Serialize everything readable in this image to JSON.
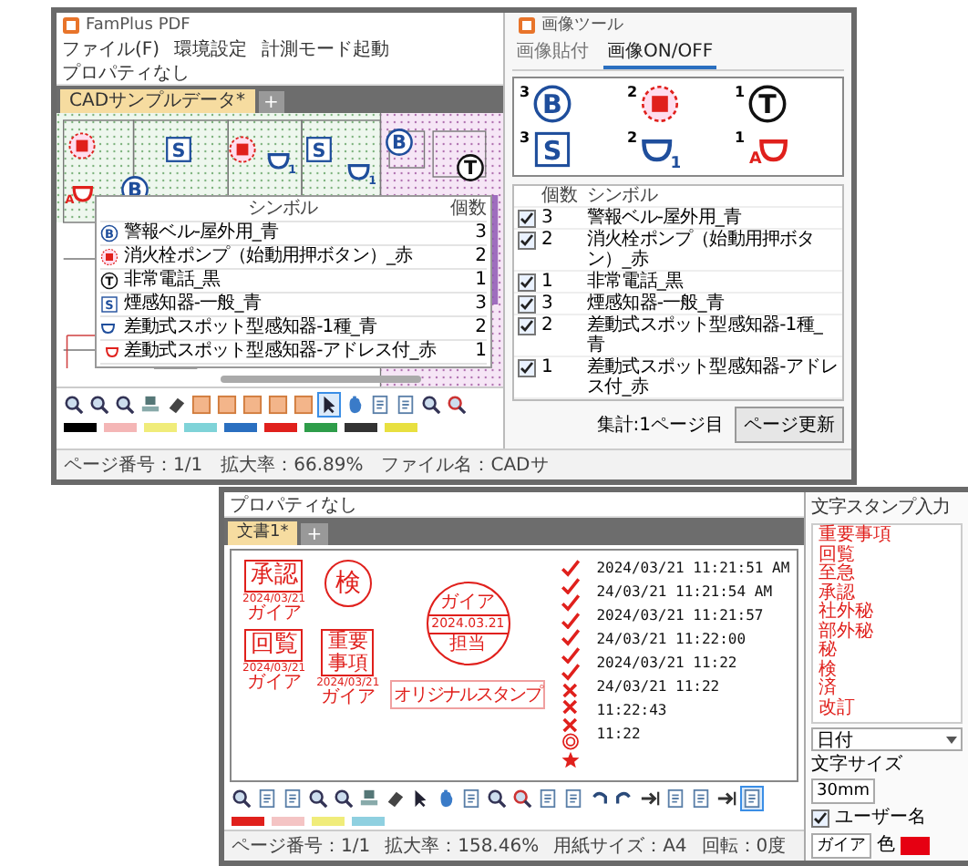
{
  "doc_window": {
    "title": "FamPlus PDF",
    "menu": [
      "ファイル(F)",
      "環境設定",
      "計測モード起動"
    ],
    "property": "プロパティなし",
    "tabs": [
      {
        "label": "CADサンプルデータ*",
        "selected": true
      }
    ],
    "add_tab": "+",
    "plan_marks": [
      {
        "kind": "square",
        "mark": "S",
        "color": "#1f4e9c"
      },
      {
        "kind": "square",
        "mark": "S",
        "color": "#1f4e9c"
      },
      {
        "kind": "circle",
        "mark": "B",
        "color": "#1f4e9c"
      },
      {
        "kind": "circle",
        "mark": "B",
        "color": "#1f4e9c"
      },
      {
        "kind": "circle",
        "mark": "T",
        "color": "#111111"
      },
      {
        "kind": "pump",
        "color": "#e0201c"
      },
      {
        "kind": "pump",
        "color": "#e0201c"
      },
      {
        "kind": "bowl",
        "mark": "1",
        "color": "#1f4e9c"
      },
      {
        "kind": "bowl",
        "mark": "1",
        "color": "#1f4e9c"
      },
      {
        "kind": "bowl-a",
        "mark": "A",
        "color": "#e0201c"
      }
    ],
    "legend": {
      "columns": [
        "シンボル",
        "個数"
      ],
      "rows": [
        {
          "kind": "circle",
          "mark": "B",
          "color": "#1f4e9c",
          "name": "警報ベル-屋外用_青",
          "count": "3"
        },
        {
          "kind": "pump",
          "color": "#e0201c",
          "name": "消火栓ポンプ（始動用押ボタン）_赤",
          "count": "2"
        },
        {
          "kind": "circle",
          "mark": "T",
          "color": "#111111",
          "name": "非常電話_黒",
          "count": "1"
        },
        {
          "kind": "square",
          "mark": "S",
          "color": "#1f4e9c",
          "name": "煙感知器-一般_青",
          "count": "3"
        },
        {
          "kind": "bowl",
          "color": "#1f4e9c",
          "name": "差動式スポット型感知器-1種_青",
          "count": "2"
        },
        {
          "kind": "bowl-a",
          "color": "#e0201c",
          "name": "差動式スポット型感知器-アドレス付_赤",
          "count": "1"
        }
      ]
    },
    "toolbar": [
      {
        "kind": "zoom",
        "selected": false
      },
      {
        "kind": "zoom",
        "selected": false
      },
      {
        "kind": "zoom",
        "selected": false
      },
      {
        "kind": "stamp",
        "selected": false
      },
      {
        "kind": "eraser",
        "selected": false
      },
      {
        "kind": "shape",
        "selected": false
      },
      {
        "kind": "shape",
        "selected": false
      },
      {
        "kind": "shape",
        "selected": false
      },
      {
        "kind": "shape",
        "selected": false
      },
      {
        "kind": "shape",
        "selected": false
      },
      {
        "kind": "pointer",
        "selected": true
      },
      {
        "kind": "hand",
        "selected": false
      },
      {
        "kind": "page",
        "selected": false
      },
      {
        "kind": "page",
        "selected": false
      },
      {
        "kind": "zoom-in",
        "selected": false
      },
      {
        "kind": "zoom-out",
        "selected": false
      }
    ],
    "palette": [
      {
        "color": "#000000"
      },
      {
        "color": "#f4b6b6"
      },
      {
        "color": "#f0ec7a"
      },
      {
        "color": "#7fd3d8"
      },
      {
        "color": "#2a6fc0"
      },
      {
        "color": "#e0201c"
      },
      {
        "color": "#2e9d4a"
      },
      {
        "color": "#333333"
      },
      {
        "color": "#e8e040"
      }
    ],
    "status": [
      "ページ番号：1/1",
      "拡大率：66.89%",
      "ファイル名：CADサ"
    ]
  },
  "image_tool": {
    "title": "画像ツール",
    "tabs": [
      {
        "label": "画像貼付",
        "selected": false
      },
      {
        "label": "画像ON/OFF",
        "selected": true
      }
    ],
    "symbols": [
      {
        "kind": "circle",
        "mark": "B",
        "color": "#1f4e9c",
        "count": "3"
      },
      {
        "kind": "pump",
        "color": "#e0201c",
        "count": "2"
      },
      {
        "kind": "circle",
        "mark": "T",
        "color": "#111111",
        "count": "1"
      },
      {
        "kind": "square",
        "mark": "S",
        "color": "#1f4e9c",
        "count": "3"
      },
      {
        "kind": "bowl",
        "mark": "1",
        "color": "#1f4e9c",
        "count": "2"
      },
      {
        "kind": "bowl-a",
        "mark": "A",
        "color": "#e0201c",
        "count": "1"
      }
    ],
    "columns": [
      "個数",
      "シンボル"
    ],
    "rows": [
      {
        "checked": true,
        "count": "3",
        "name": "警報ベル-屋外用_青"
      },
      {
        "checked": true,
        "count": "2",
        "name": "消火栓ポンプ（始動用押ボタン）_赤"
      },
      {
        "checked": true,
        "count": "1",
        "name": "非常電話_黒"
      },
      {
        "checked": true,
        "count": "3",
        "name": "煙感知器-一般_青"
      },
      {
        "checked": true,
        "count": "2",
        "name": "差動式スポット型感知器-1種_青"
      },
      {
        "checked": true,
        "count": "1",
        "name": "差動式スポット型感知器-アドレス付_赤"
      }
    ],
    "total": "集計:1ページ目",
    "update_button": "ページ更新"
  },
  "stamp_window": {
    "property": "プロパティなし",
    "tabs": [
      {
        "label": "文書1*",
        "selected": true
      }
    ],
    "add_tab": "+",
    "stamps": [
      {
        "kind": "box",
        "text": "承認",
        "date": "2024/03/21",
        "name": "ガイア"
      },
      {
        "kind": "circle",
        "text": "検"
      },
      {
        "kind": "box",
        "text": "回覧",
        "date": "2024/03/21",
        "name": "ガイア"
      },
      {
        "kind": "tall-box",
        "text": "重要事項",
        "date": "2024/03/21",
        "name": "ガイア"
      }
    ],
    "round_stamp": {
      "top": "ガイア",
      "date": "2024.03.21",
      "bottom": "担当"
    },
    "original_stamp": "オリジナルスタンプ",
    "marks": [
      {
        "kind": "check"
      },
      {
        "kind": "check"
      },
      {
        "kind": "check"
      },
      {
        "kind": "check"
      },
      {
        "kind": "check"
      },
      {
        "kind": "check"
      },
      {
        "kind": "check"
      },
      {
        "kind": "cross"
      },
      {
        "kind": "cross"
      },
      {
        "kind": "cross"
      },
      {
        "kind": "double-circle"
      },
      {
        "kind": "star"
      }
    ],
    "dates": [
      "2024/03/21 11:21:51 AM",
      "24/03/21 11:21:54 AM",
      "2024/03/21 11:21:57",
      "24/03/21 11:22:00",
      "2024/03/21 11:22",
      "24/03/21 11:22",
      "11:22:43",
      "11:22"
    ],
    "toolbar": [
      {
        "kind": "zoom",
        "selected": false
      },
      {
        "kind": "page",
        "selected": false
      },
      {
        "kind": "page",
        "selected": false
      },
      {
        "kind": "zoom",
        "selected": false
      },
      {
        "kind": "zoom",
        "selected": false
      },
      {
        "kind": "stamp",
        "selected": false
      },
      {
        "kind": "eraser",
        "selected": false
      },
      {
        "kind": "pointer",
        "selected": false
      },
      {
        "kind": "hand",
        "selected": false
      },
      {
        "kind": "page",
        "selected": false
      },
      {
        "kind": "zoom-in",
        "selected": false
      },
      {
        "kind": "zoom-out",
        "selected": false
      },
      {
        "kind": "page",
        "selected": false
      },
      {
        "kind": "page",
        "selected": false
      },
      {
        "kind": "undo",
        "selected": false
      },
      {
        "kind": "redo",
        "selected": false
      },
      {
        "kind": "arrow",
        "selected": false
      },
      {
        "kind": "page",
        "selected": false
      },
      {
        "kind": "page",
        "selected": false
      },
      {
        "kind": "arrow",
        "selected": false
      },
      {
        "kind": "page",
        "selected": true
      }
    ],
    "palette": [
      {
        "color": "#e0201c"
      },
      {
        "color": "#f4c4c4"
      },
      {
        "color": "#f0ec7a"
      },
      {
        "color": "#8fd0e0"
      }
    ],
    "status": [
      "ページ番号：1/1",
      "拡大率：158.46%",
      "用紙サイズ：A4",
      "回転：0度"
    ]
  },
  "stamp_panel": {
    "title": "文字スタンプ入力",
    "items": [
      "重要事項",
      "回覧",
      "至急",
      "承認",
      "社外秘",
      "部外秘",
      "秘",
      "検",
      "済",
      "改訂"
    ],
    "date_select": "日付",
    "size_label": "文字サイズ",
    "size_value": "30mm",
    "user_name": {
      "checked": true,
      "label": "ユーザー名",
      "value": "ガイア"
    },
    "color_label": "色",
    "color": "#e60012"
  }
}
